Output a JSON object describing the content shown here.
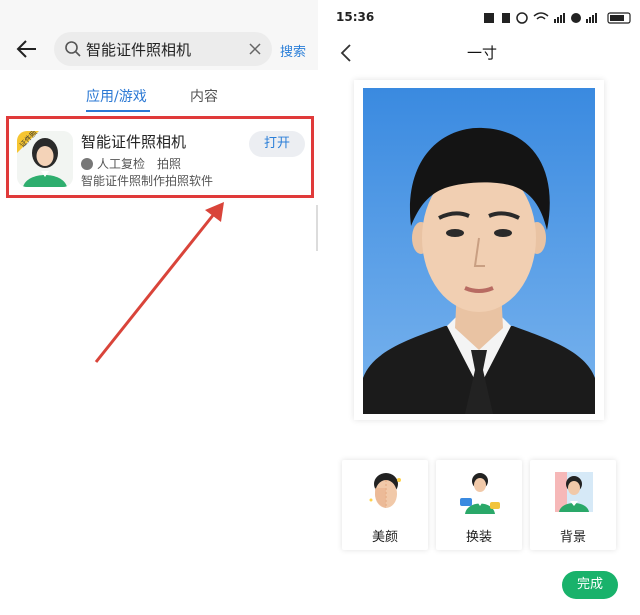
{
  "left_panel": {
    "search": {
      "query": "智能证件照相机",
      "action_label": "搜索"
    },
    "tabs": [
      {
        "label": "应用/游戏",
        "active": true
      },
      {
        "label": "内容",
        "active": false
      }
    ],
    "app_result": {
      "title": "智能证件照相机",
      "tag1": "人工复检",
      "tag2": "拍照",
      "description": "智能证件照制作拍照软件",
      "open_label": "打开",
      "icon_badge": "证件照"
    },
    "highlight_color": "#e03a3a",
    "accent_color": "#2c79d4"
  },
  "right_panel": {
    "status": {
      "time": "15:36"
    },
    "nav_title": "一寸",
    "photo_background_color": "#3f8fe0",
    "options": [
      {
        "label": "美颜",
        "icon": "beauty-face-icon"
      },
      {
        "label": "换装",
        "icon": "change-outfit-icon"
      },
      {
        "label": "背景",
        "icon": "background-icon"
      }
    ],
    "done_label": "完成",
    "done_color": "#19b26b"
  }
}
